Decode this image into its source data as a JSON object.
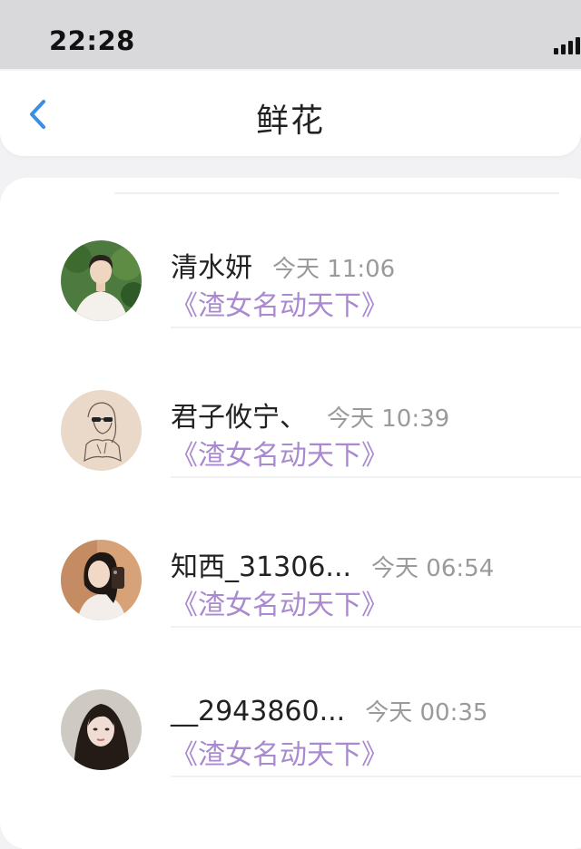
{
  "status_bar": {
    "time": "22:28"
  },
  "header": {
    "title": "鲜花",
    "back_icon": "chevron-left-icon",
    "accent_color": "#3a8ee6"
  },
  "list": {
    "items": [
      {
        "name": "清水妍",
        "time": "今天 11:06",
        "message": "《渣女名动天下》",
        "avatar_icon": "avatar-photo-icon"
      },
      {
        "name": "君子攸宁、",
        "time": "今天 10:39",
        "message": "《渣女名动天下》",
        "avatar_icon": "avatar-sketch-icon"
      },
      {
        "name": "知西_31306...",
        "time": "今天 06:54",
        "message": "《渣女名动天下》",
        "avatar_icon": "avatar-photo-icon"
      },
      {
        "name": "__2943860...",
        "time": "今天 00:35",
        "message": "《渣女名动天下》",
        "avatar_icon": "avatar-photo-icon"
      }
    ],
    "message_color": "#a989cf",
    "name_color": "#222222",
    "time_color": "#9a9a9a"
  }
}
